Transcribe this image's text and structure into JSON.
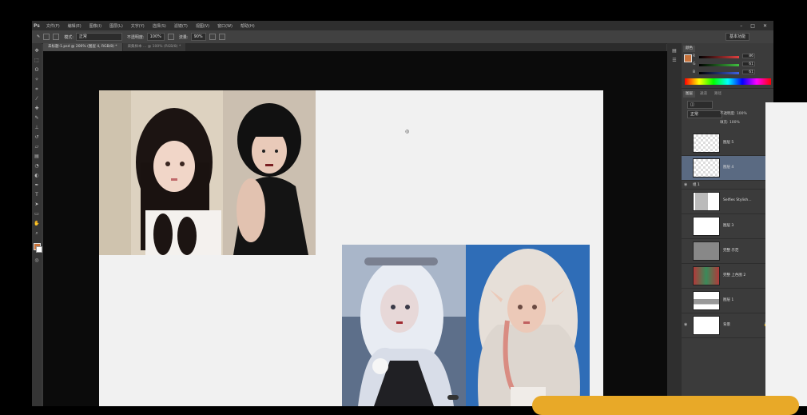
{
  "menu": {
    "logo": "Ps",
    "items": [
      "文件(F)",
      "编辑(E)",
      "图像(I)",
      "图层(L)",
      "文字(Y)",
      "选择(S)",
      "滤镜(T)",
      "视图(V)",
      "窗口(W)",
      "帮助(H)"
    ],
    "window_controls": [
      "–",
      "□",
      "✕"
    ]
  },
  "options": {
    "mode_label": "模式:",
    "mode_value": "正常",
    "opacity_label": "不透明度:",
    "opacity_value": "100%",
    "flow_label": "流量:",
    "flow_value": "90%",
    "workspace": "基本功能"
  },
  "tabs": [
    "未标题-1.psd @ 200% (图层 4, RGB/8) *",
    "采集样本 ... @ 100% (RGB/8) *"
  ],
  "panels": {
    "color_tab": "颜色",
    "channels": [
      {
        "label": "R",
        "value": "86",
        "color": "#e04040"
      },
      {
        "label": "G",
        "value": "61",
        "color": "#40c040"
      },
      {
        "label": "B",
        "value": "61",
        "color": "#4060e0"
      }
    ],
    "layers_tabs": [
      "图层",
      "通道",
      "路径"
    ],
    "blend_mode": "正常",
    "opacity_label": "不透明度: 100%",
    "fill_label": "填充: 100%",
    "group_name": "组 1"
  },
  "layers": [
    {
      "name": "图层 5",
      "selected": false
    },
    {
      "name": "图层 4",
      "selected": true
    },
    {
      "name": "组 1",
      "selected": false
    },
    {
      "name": "Selfies Stylish...",
      "selected": false
    },
    {
      "name": "图层 3",
      "selected": false
    },
    {
      "name": "完整 示范",
      "selected": false
    },
    {
      "name": "完整 上色图 2",
      "selected": false
    },
    {
      "name": "图层 1",
      "selected": false
    },
    {
      "name": "背景",
      "selected": false
    }
  ],
  "colors": {
    "app_bg": "#3a3a3a",
    "canvas_bg": "#0b0b0b",
    "document": "#f1f1f1",
    "selected_layer": "#5a6a82",
    "banner": "#e8a928"
  }
}
